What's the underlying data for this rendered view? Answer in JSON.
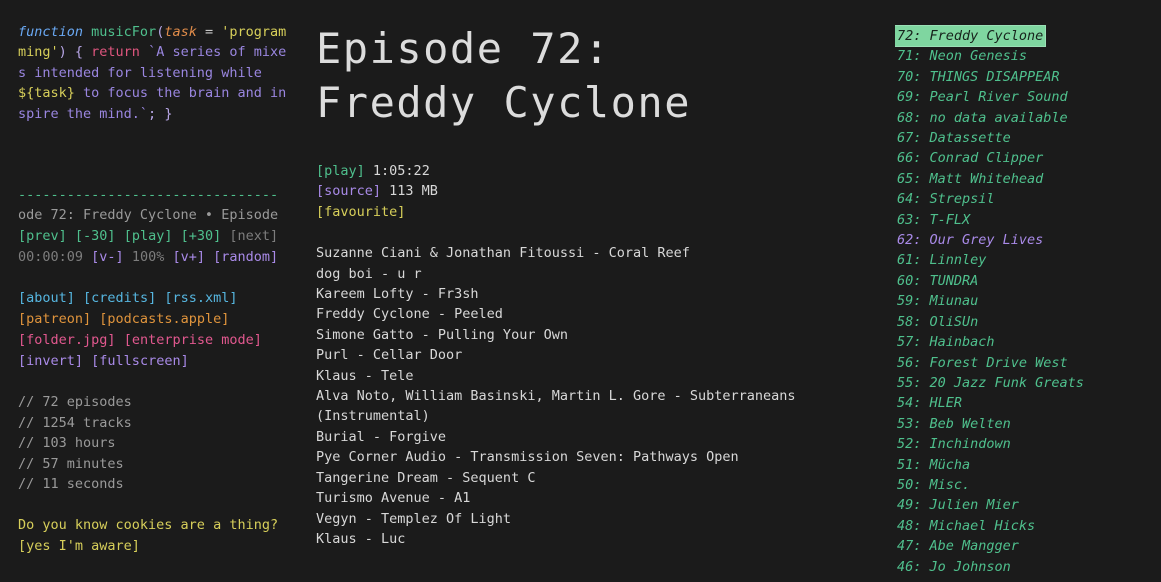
{
  "theme": {
    "background": "#1b1b1b",
    "text": "#d8d8d8",
    "accent_green": "#4fc08d",
    "accent_purple": "#a98ae8",
    "accent_yellow": "#d7cf5a",
    "accent_pink": "#e2588f",
    "accent_orange": "#e0943c",
    "accent_cyan": "#56b6e0",
    "highlight_bg": "#7fd6a0",
    "dim": "#7d7d7d"
  },
  "code_snippet": {
    "keyword": "function",
    "fn_name": " musicFor",
    "paren_open": "(",
    "param": "task",
    "equals": " = ",
    "string_arg": "'programming'",
    "paren_close": ")",
    "brace_open": " { ",
    "return_kw": "return",
    "template": " `A series of mixes intended for listening while ",
    "interp": "${task}",
    "template2": " to focus the brain and inspire the mind.`",
    "semicolon": "; ",
    "brace_close": "}"
  },
  "player": {
    "separator": "--------------------------------",
    "marquee": "ode 72: Freddy Cyclone • Episode",
    "controls": [
      {
        "label": "[prev]",
        "color": "green",
        "interactable": true
      },
      {
        "label": "[-30]",
        "color": "green",
        "interactable": true
      },
      {
        "label": "[play]",
        "color": "green",
        "interactable": true
      },
      {
        "label": "[+30]",
        "color": "green",
        "interactable": true
      },
      {
        "label": "[next]",
        "color": "dim",
        "interactable": false
      }
    ],
    "elapsed": "00:00:09",
    "vol_down": "[v-]",
    "volume": "100%",
    "vol_up": "[v+]",
    "random": "[random]"
  },
  "links": {
    "row1": [
      {
        "label": "[about]",
        "color": "cyan"
      },
      {
        "label": "[credits]",
        "color": "cyan"
      },
      {
        "label": "[rss.xml]",
        "color": "cyan"
      }
    ],
    "row2": [
      {
        "label": "[patreon]",
        "color": "orange"
      },
      {
        "label": "[podcasts.apple]",
        "color": "orange"
      }
    ],
    "row3": [
      {
        "label": "[folder.jpg]",
        "color": "pink"
      },
      {
        "label": "[enterprise mode]",
        "color": "pink"
      }
    ],
    "row4": [
      {
        "label": "[invert]",
        "color": "violet"
      },
      {
        "label": "[fullscreen]",
        "color": "violet"
      }
    ]
  },
  "stats": [
    "// 72 episodes",
    "// 1254 tracks",
    "// 103 hours",
    "// 57 minutes",
    "// 11 seconds"
  ],
  "cookie_notice": {
    "question": "Do you know cookies are a thing?",
    "accept": "[yes I'm aware]"
  },
  "episode": {
    "title": "Episode 72:\nFreddy Cyclone",
    "play_label": "[play]",
    "duration": "1:05:22",
    "source_label": "[source]",
    "filesize": "113 MB",
    "favourite_label": "[favourite]",
    "tracks": [
      "Suzanne Ciani & Jonathan Fitoussi - Coral Reef",
      "dog boi - u r",
      "Kareem Lofty - Fr3sh",
      "Freddy Cyclone - Peeled",
      "Simone Gatto - Pulling Your Own",
      "Purl - Cellar Door",
      "Klaus - Tele",
      "Alva Noto, William Basinski, Martin L. Gore - Subterraneans",
      "(Instrumental)",
      "Burial - Forgive",
      "Pye Corner Audio - Transmission Seven: Pathways Open",
      "Tangerine Dream - Sequent C",
      "Turismo Avenue - A1",
      "Vegyn - Templez Of Light",
      "Klaus - Luc"
    ]
  },
  "episode_list": [
    {
      "label": "72: Freddy Cyclone",
      "state": "selected"
    },
    {
      "label": "71: Neon Genesis",
      "state": "normal"
    },
    {
      "label": "70: THINGS DISAPPEAR",
      "state": "normal"
    },
    {
      "label": "69: Pearl River Sound",
      "state": "normal"
    },
    {
      "label": "68: no data available",
      "state": "normal"
    },
    {
      "label": "67: Datassette",
      "state": "normal"
    },
    {
      "label": "66: Conrad Clipper",
      "state": "normal"
    },
    {
      "label": "65: Matt Whitehead",
      "state": "normal"
    },
    {
      "label": "64: Strepsil",
      "state": "normal"
    },
    {
      "label": "63: T-FLX",
      "state": "normal"
    },
    {
      "label": "62: Our Grey Lives",
      "state": "visited"
    },
    {
      "label": "61: Linnley",
      "state": "normal"
    },
    {
      "label": "60: TUNDRA",
      "state": "normal"
    },
    {
      "label": "59: Miunau",
      "state": "normal"
    },
    {
      "label": "58: OliSUn",
      "state": "normal"
    },
    {
      "label": "57: Hainbach",
      "state": "normal"
    },
    {
      "label": "56: Forest Drive West",
      "state": "normal"
    },
    {
      "label": "55: 20 Jazz Funk Greats",
      "state": "normal"
    },
    {
      "label": "54: HLER",
      "state": "normal"
    },
    {
      "label": "53: Beb Welten",
      "state": "normal"
    },
    {
      "label": "52: Inchindown",
      "state": "normal"
    },
    {
      "label": "51: Mücha",
      "state": "normal"
    },
    {
      "label": "50: Misc.",
      "state": "normal"
    },
    {
      "label": "49: Julien Mier",
      "state": "normal"
    },
    {
      "label": "48: Michael Hicks",
      "state": "normal"
    },
    {
      "label": "47: Abe Mangger",
      "state": "normal"
    },
    {
      "label": "46: Jo Johnson",
      "state": "normal"
    }
  ]
}
